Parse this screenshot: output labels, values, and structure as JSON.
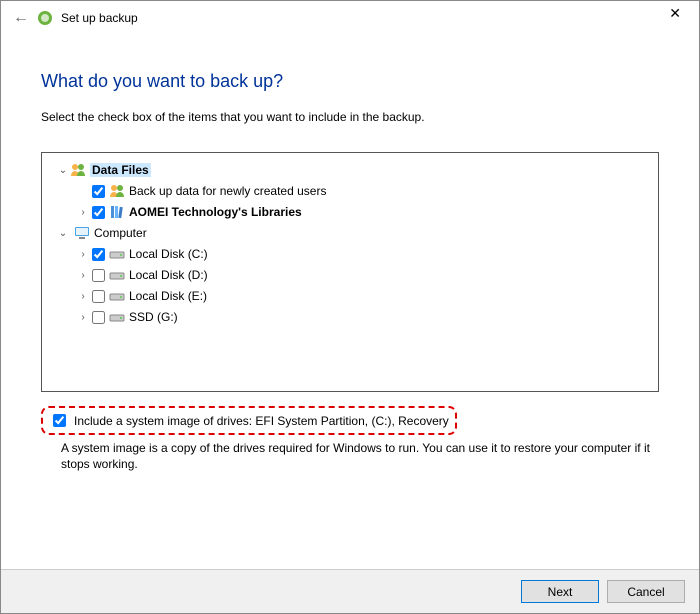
{
  "window": {
    "title": "Set up backup"
  },
  "page": {
    "heading": "What do you want to back up?",
    "instruction": "Select the check box of the items that you want to include in the backup."
  },
  "tree": {
    "data_files": {
      "label": "Data Files"
    },
    "newly_created": {
      "label": "Back up data for newly created users"
    },
    "libraries": {
      "label": "AOMEI Technology's Libraries"
    },
    "computer": {
      "label": "Computer"
    },
    "disk_c": {
      "label": "Local Disk (C:)"
    },
    "disk_d": {
      "label": "Local Disk (D:)"
    },
    "disk_e": {
      "label": "Local Disk (E:)"
    },
    "ssd_g": {
      "label": "SSD (G:)"
    }
  },
  "system_image": {
    "checkbox_label": "Include a system image of drives: EFI System Partition, (C:), Recovery",
    "description": "A system image is a copy of the drives required for Windows to run. You can use it to restore your computer if it stops working."
  },
  "buttons": {
    "next": "Next",
    "cancel": "Cancel"
  }
}
